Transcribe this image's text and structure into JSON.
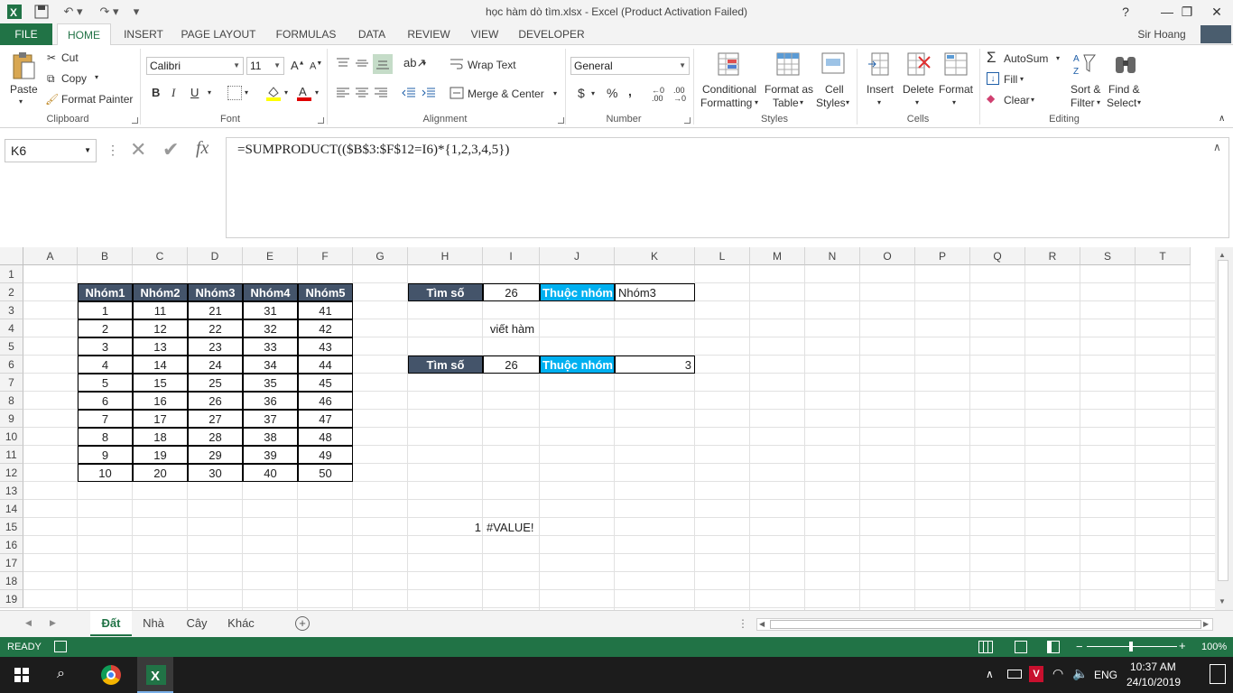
{
  "window": {
    "title": "học hàm dò tìm.xlsx - Excel (Product Activation Failed)",
    "user": "Sir Hoang"
  },
  "tabs": [
    "FILE",
    "HOME",
    "INSERT",
    "PAGE LAYOUT",
    "FORMULAS",
    "DATA",
    "REVIEW",
    "VIEW",
    "DEVELOPER"
  ],
  "ribbon": {
    "clipboard": {
      "paste": "Paste",
      "cut": "Cut",
      "copy": "Copy",
      "format_painter": "Format Painter",
      "label": "Clipboard"
    },
    "font": {
      "name": "Calibri",
      "size": "11",
      "label": "Font"
    },
    "alignment": {
      "wrap": "Wrap Text",
      "merge": "Merge & Center",
      "label": "Alignment"
    },
    "number": {
      "format": "General",
      "label": "Number"
    },
    "styles": {
      "cond1": "Conditional",
      "cond2": "Formatting",
      "fmt1": "Format as",
      "fmt2": "Table",
      "cell1": "Cell",
      "cell2": "Styles",
      "label": "Styles"
    },
    "cells": {
      "insert": "Insert",
      "delete": "Delete",
      "format": "Format",
      "label": "Cells"
    },
    "editing": {
      "autosum": "AutoSum",
      "fill": "Fill",
      "clear": "Clear",
      "sort1": "Sort &",
      "sort2": "Filter",
      "find1": "Find &",
      "find2": "Select",
      "label": "Editing"
    }
  },
  "formula_bar": {
    "name_box": "K6",
    "formula": "=SUMPRODUCT(($B$3:$F$12=I6)*{1,2,3,4,5})"
  },
  "columns": [
    "A",
    "B",
    "C",
    "D",
    "E",
    "F",
    "G",
    "H",
    "I",
    "J",
    "K",
    "L",
    "M",
    "N",
    "O",
    "P",
    "Q",
    "R",
    "S",
    "T"
  ],
  "rows": [
    "1",
    "2",
    "3",
    "4",
    "5",
    "6",
    "7",
    "8",
    "9",
    "10",
    "11",
    "12",
    "13",
    "14",
    "15",
    "16",
    "17",
    "18",
    "19"
  ],
  "table": {
    "headers": [
      "Nhóm1",
      "Nhóm2",
      "Nhóm3",
      "Nhóm4",
      "Nhóm5"
    ],
    "rows": [
      [
        "1",
        "11",
        "21",
        "31",
        "41"
      ],
      [
        "2",
        "12",
        "22",
        "32",
        "42"
      ],
      [
        "3",
        "13",
        "23",
        "33",
        "43"
      ],
      [
        "4",
        "14",
        "24",
        "34",
        "44"
      ],
      [
        "5",
        "15",
        "25",
        "35",
        "45"
      ],
      [
        "6",
        "16",
        "26",
        "36",
        "46"
      ],
      [
        "7",
        "17",
        "27",
        "37",
        "47"
      ],
      [
        "8",
        "18",
        "28",
        "38",
        "48"
      ],
      [
        "9",
        "19",
        "29",
        "39",
        "49"
      ],
      [
        "10",
        "20",
        "30",
        "40",
        "50"
      ]
    ]
  },
  "lookup1": {
    "label": "Tìm số",
    "value": "26",
    "result_label": "Thuộc nhóm",
    "result": "Nhóm3"
  },
  "note": "viết hàm",
  "lookup2": {
    "label": "Tìm số",
    "value": "26",
    "result_label": "Thuộc nhóm",
    "result": "3"
  },
  "row15": {
    "h": "1",
    "i": "#VALUE!"
  },
  "sheets": [
    "Đất",
    "Nhà",
    "Cây",
    "Khác"
  ],
  "status": {
    "mode": "READY",
    "zoom": "100%"
  },
  "taskbar": {
    "lang": "ENG",
    "time": "10:37 AM",
    "date": "24/10/2019"
  }
}
